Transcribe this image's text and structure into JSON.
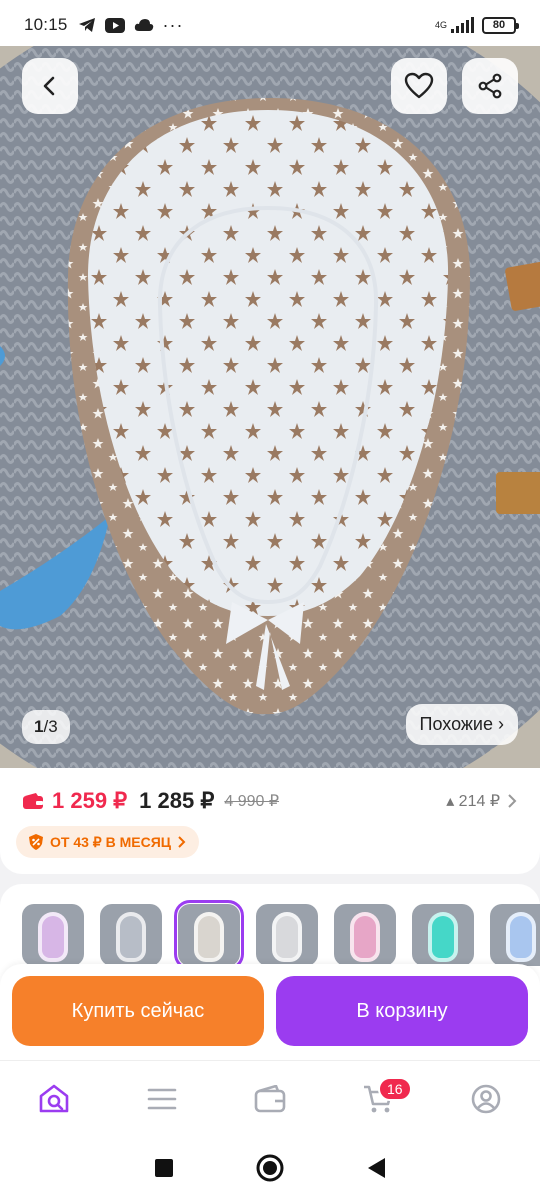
{
  "status_bar": {
    "time": "10:15",
    "network": "4G",
    "battery": "80"
  },
  "gallery": {
    "counter_current": "1",
    "counter_separator": "/",
    "counter_total": "3",
    "similar_label": "Похожие ›"
  },
  "price": {
    "discount_price": "1 259 ₽",
    "regular_price": "1 285 ₽",
    "old_price": "4 990 ₽",
    "cashback": "▴ 214 ₽",
    "installment": "ОТ 43 ₽ В МЕСЯЦ"
  },
  "variants": [
    {
      "color": "#d7b6e6",
      "selected": false
    },
    {
      "color": "#b7bdc7",
      "selected": false
    },
    {
      "color": "#d9d5cf",
      "selected": true
    },
    {
      "color": "#d8d9dc",
      "selected": false
    },
    {
      "color": "#e7a6c7",
      "selected": false
    },
    {
      "color": "#45d7c8",
      "selected": false
    },
    {
      "color": "#a9c6ef",
      "selected": false
    }
  ],
  "actions": {
    "buy_now": "Купить сейчас",
    "add_to_cart": "В корзину"
  },
  "bottom_nav": {
    "cart_badge": "16"
  },
  "colors": {
    "accent_purple": "#9b3cf0",
    "accent_orange": "#f6802a",
    "price_red": "#f0294e",
    "installment_orange": "#f06a00"
  },
  "icons": {
    "back": "chevron-left-icon",
    "favorite": "heart-icon",
    "share": "share-icon",
    "nav": [
      "home-search-icon",
      "catalog-icon",
      "wallet-icon",
      "cart-icon",
      "profile-icon"
    ]
  }
}
